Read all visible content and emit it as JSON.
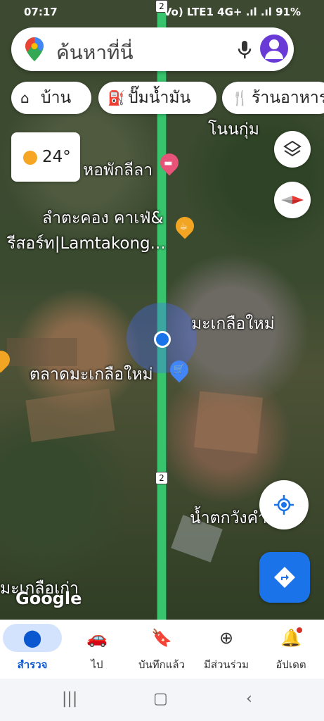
{
  "status_bar": {
    "time": "07:17",
    "right_text": "Vo) LTE1 4G+ .ıl .ıl 91%"
  },
  "search": {
    "placeholder": "ค้นหาที่นี่"
  },
  "chips": [
    {
      "label": "บ้าน",
      "icon": "home-icon"
    },
    {
      "label": "ปั๊มน้ำมัน",
      "icon": "gas-station-icon"
    },
    {
      "label": "ร้านอาหาร",
      "icon": "restaurant-icon"
    }
  ],
  "weather": {
    "temp": "24°",
    "icon": "partly-cloudy-icon"
  },
  "map": {
    "road_number": "2",
    "places": [
      "โนนกุ่ม",
      "หอพักลีลา",
      "ลำตะคอง คาเฟ่&",
      "รีสอร์ท|Lamtakong...",
      "มะเกลือใหม่",
      "ตลาดมะเกลือใหม่",
      "น้ำตกวังคำพาย",
      "มะเกลือเก่า"
    ],
    "attribution": "Google",
    "colors": {
      "route": "#38c46c",
      "location": "#1a73e8"
    }
  },
  "bottom_nav": [
    {
      "label": "สำรวจ",
      "icon": "location-pin-icon",
      "active": true
    },
    {
      "label": "ไป",
      "icon": "car-icon"
    },
    {
      "label": "บันทึกแล้ว",
      "icon": "bookmark-icon"
    },
    {
      "label": "มีส่วนร่วม",
      "icon": "add-circle-icon"
    },
    {
      "label": "อัปเดต",
      "icon": "bell-icon"
    }
  ]
}
